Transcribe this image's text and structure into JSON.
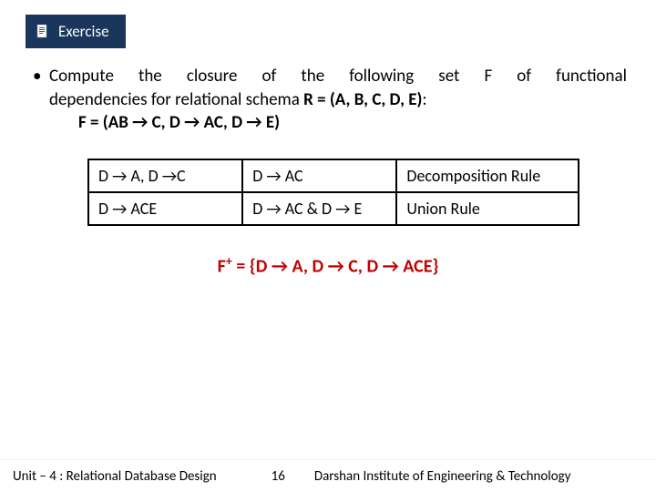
{
  "header": {
    "title": "Exercise"
  },
  "bullet": {
    "line1": "Compute the closure of the following set F of functional",
    "line2_prefix": "dependencies for relational schema ",
    "line2_bold": "R = (A, B, C, D, E)",
    "line2_suffix": ":",
    "line3": "F = (AB → C, D → AC, D → E)"
  },
  "table": {
    "rows": [
      {
        "c1": "D → A, D →C",
        "c2": "D → AC",
        "c3": "Decomposition Rule"
      },
      {
        "c1": "D → ACE",
        "c2": "D → AC & D → E",
        "c3": "Union Rule"
      }
    ]
  },
  "closure": {
    "label": "F",
    "sup": "+",
    "rest": " = {D → A, D → C, D → ACE}"
  },
  "footer": {
    "left": "Unit – 4 : Relational Database Design",
    "page": "16",
    "right": "Darshan Institute of Engineering & Technology"
  }
}
